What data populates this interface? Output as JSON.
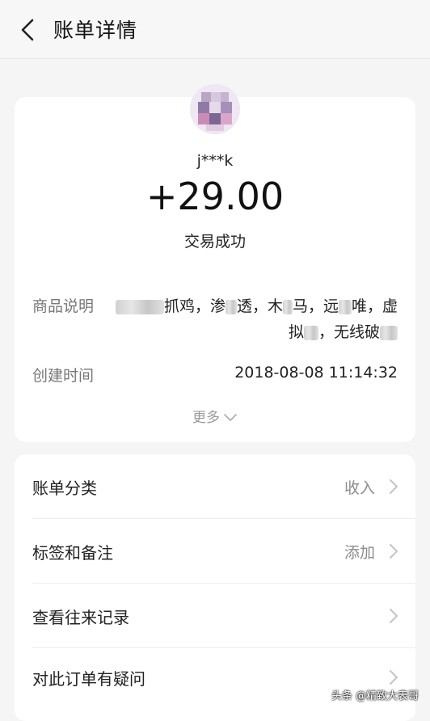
{
  "header": {
    "title": "账单详情"
  },
  "summary": {
    "username": "j***k",
    "amount": "+29.00",
    "status": "交易成功",
    "product_label": "商品说明",
    "product_value_line1_a": "抓鸡，渗",
    "product_value_line1_b": "透，木",
    "product_value_line1_c": "马，远",
    "product_value_line1_d": "唯，虚",
    "product_value_line2_a": "拟",
    "product_value_line2_b": "，无线破",
    "created_label": "创建时间",
    "created_value": "2018-08-08 11:14:32",
    "more_label": "更多"
  },
  "actions": [
    {
      "label": "账单分类",
      "value": "收入"
    },
    {
      "label": "标签和备注",
      "value": "添加"
    },
    {
      "label": "查看往来记录",
      "value": ""
    },
    {
      "label": "对此订单有疑问",
      "value": ""
    }
  ],
  "watermark": "头条 @精致大表哥"
}
